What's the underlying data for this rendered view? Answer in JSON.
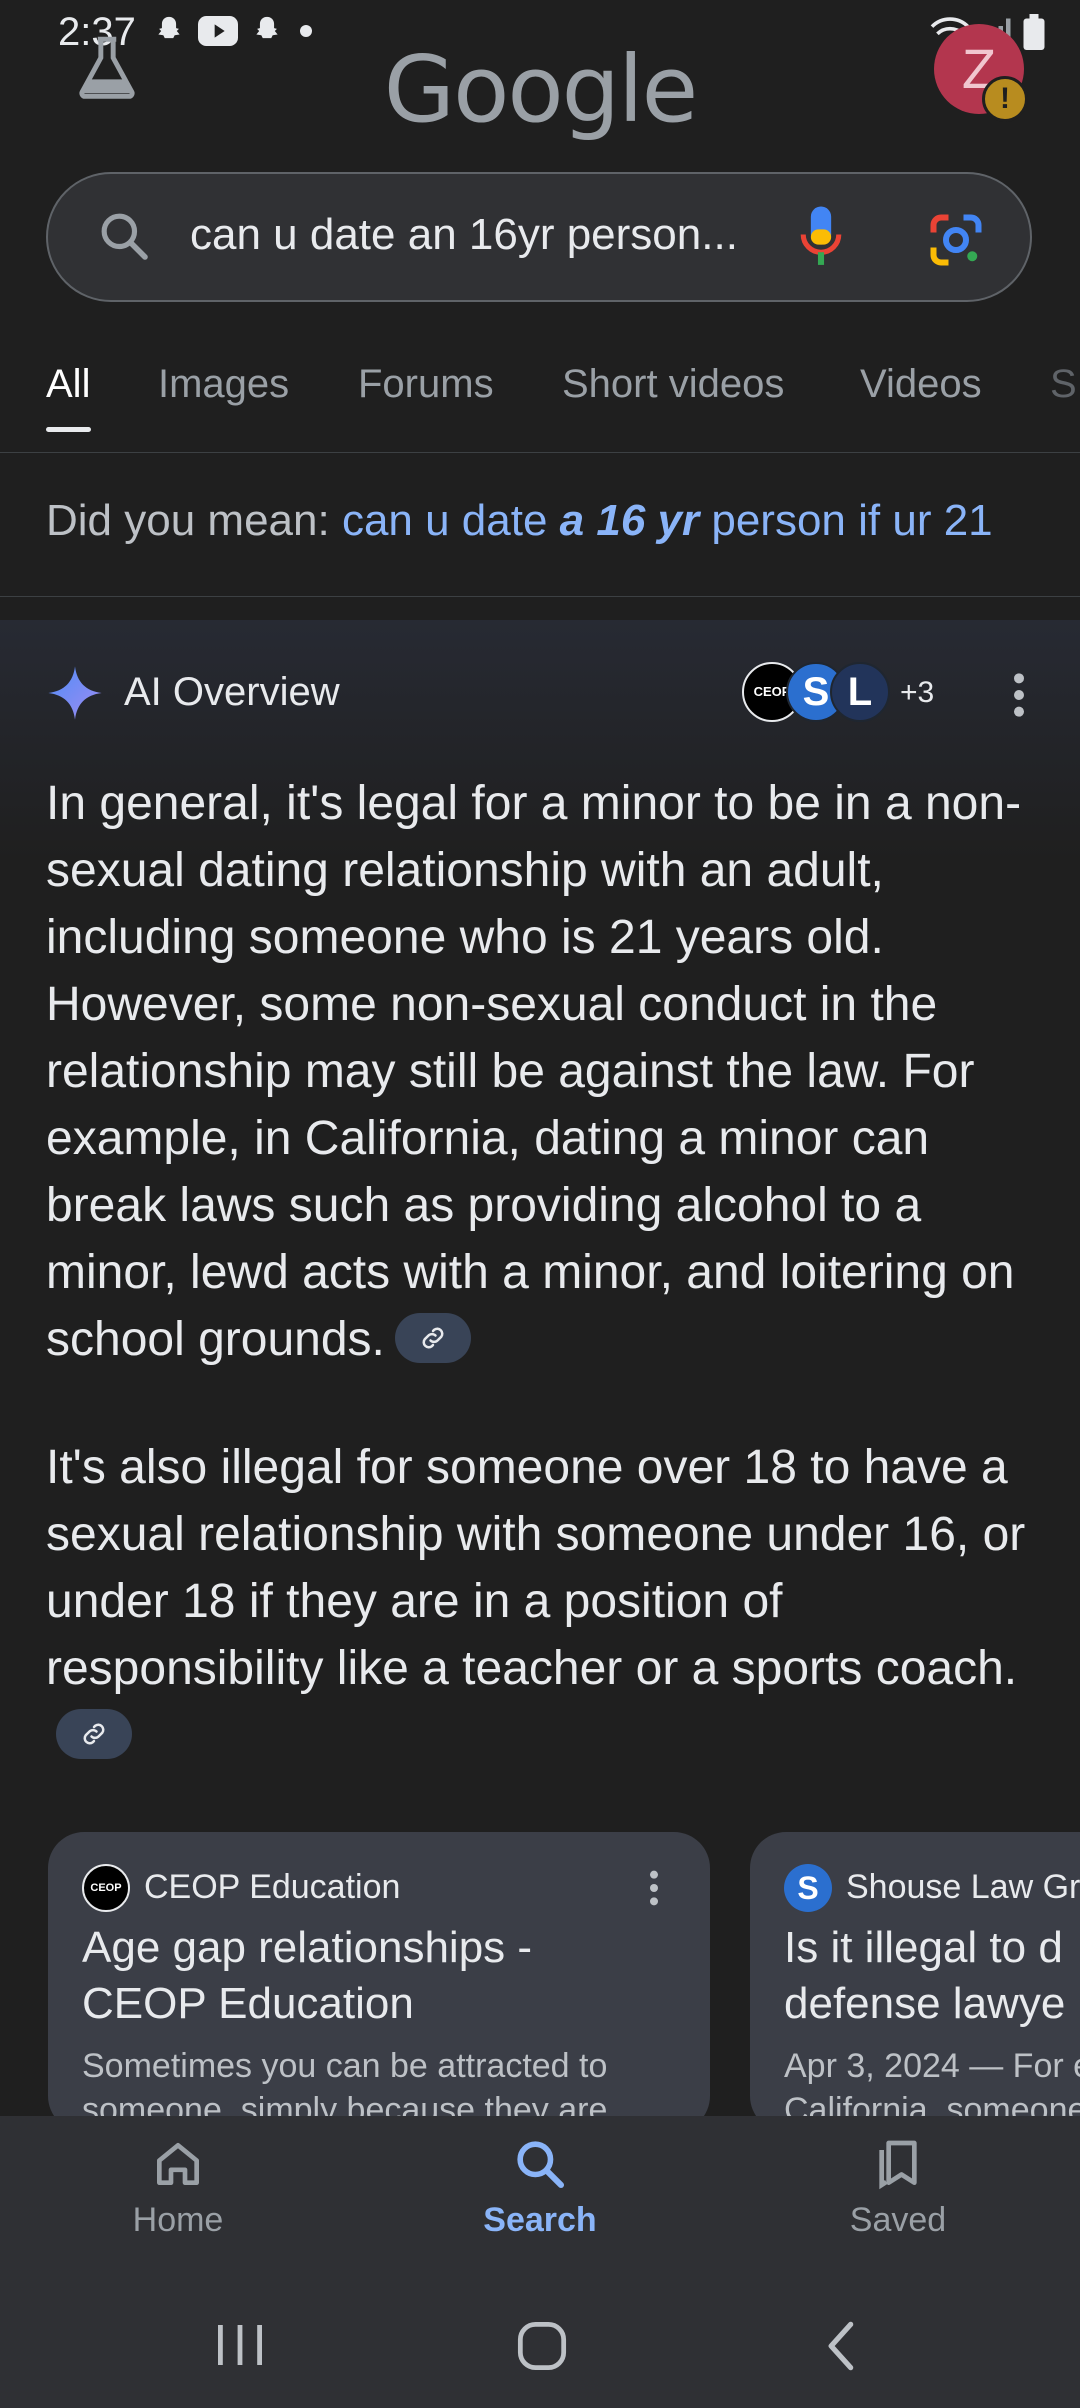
{
  "status_bar": {
    "time": "2:37"
  },
  "header": {
    "logo": "Google",
    "avatar_letter": "Z",
    "avatar_warning": "!"
  },
  "search": {
    "query": "can u date an 16yr person..."
  },
  "tabs": [
    {
      "label": "All",
      "active": true
    },
    {
      "label": "Images"
    },
    {
      "label": "Forums"
    },
    {
      "label": "Short videos"
    },
    {
      "label": "Videos"
    },
    {
      "label": "S"
    }
  ],
  "did_you_mean": {
    "prefix": "Did you mean: ",
    "part1": "can u date ",
    "bold": "a 16 yr",
    "part2": " person if ur 21"
  },
  "ai_overview": {
    "title": "AI Overview",
    "source_count": "+3",
    "source_logos": [
      "CEOP",
      "S",
      "L"
    ],
    "paragraph1": "In general, it's legal for a minor to be in a non-sexual dating relationship with an adult, including someone who is 21 years old. However, some non-sexual conduct in the relationship may still be against the law. For example, in California, dating a minor can break laws such as providing alcohol to a minor, lewd acts with a minor, and loitering on school grounds.",
    "paragraph2": "It's also illegal for someone over 18 to have a sexual relationship with someone under 16, or under 18 if they are in a position of responsibility like a teacher or a sports coach."
  },
  "cards": [
    {
      "source": "CEOP Education",
      "logo": "CEOP",
      "title_line1": "Age gap relationships -",
      "title_line2": "CEOP Education",
      "snippet_line1": "Sometimes you can be attracted to",
      "snippet_line2": "someone, simply because they are"
    },
    {
      "source": "Shouse Law Gro",
      "logo": "S",
      "title_line1": "Is it illegal to d",
      "title_line2": "defense lawye",
      "snippet_line1": "Apr 3, 2024 — For e",
      "snippet_line2": "California, someone"
    }
  ],
  "bottom_nav": [
    {
      "label": "Home",
      "icon": "home-icon"
    },
    {
      "label": "Search",
      "icon": "search-icon",
      "active": true
    },
    {
      "label": "Saved",
      "icon": "saved-icon"
    }
  ],
  "colors": {
    "background": "#1f1f1f",
    "accent": "#8ab4f8",
    "surface": "#303134"
  }
}
